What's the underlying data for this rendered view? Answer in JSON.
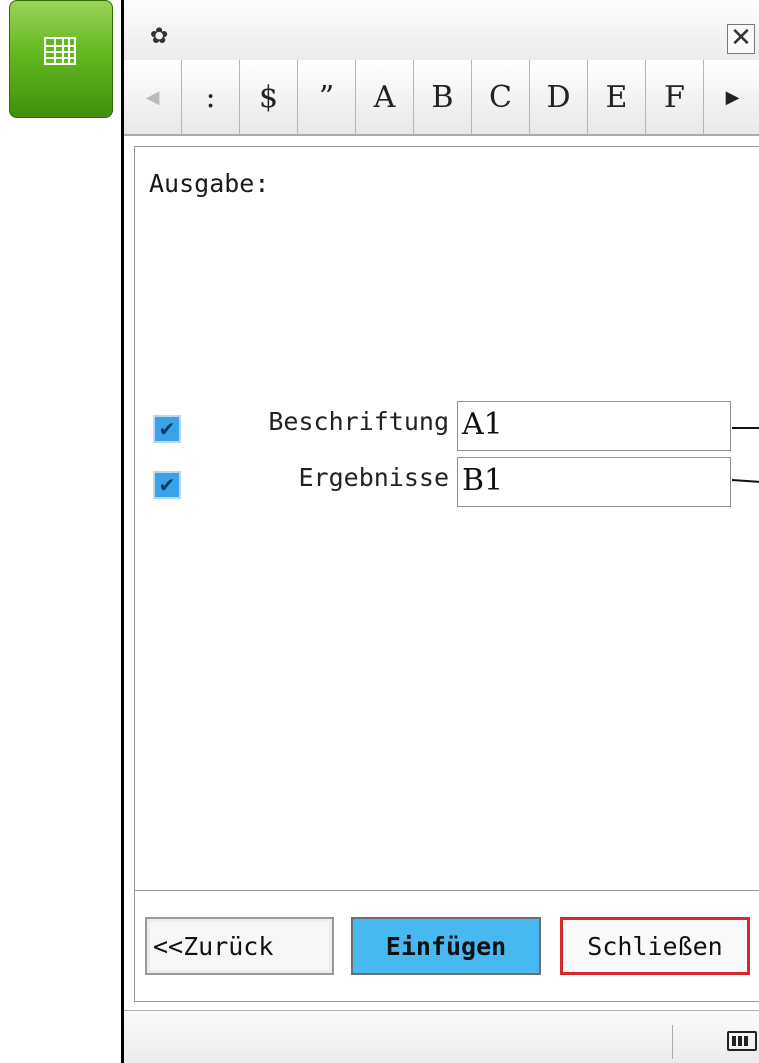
{
  "app_icon": {
    "icon": "spreadsheet-grid-icon"
  },
  "titlebar": {
    "settings_icon": "gear-icon",
    "close_label": "✕"
  },
  "keybar": {
    "keys": [
      "◀",
      ":",
      "$",
      "”",
      "A",
      "B",
      "C",
      "D",
      "E",
      "F",
      "▶"
    ]
  },
  "panel": {
    "heading": "Ausgabe:",
    "rows": [
      {
        "label": "Beschriftung",
        "value": "A1",
        "checked": true
      },
      {
        "label": "Ergebnisse",
        "value": "B1",
        "checked": true
      }
    ]
  },
  "buttons": {
    "back": "<<Zurück",
    "insert": "Einfügen",
    "close": "Schließen"
  },
  "status": {
    "battery_icon": "battery-icon"
  },
  "colors": {
    "accent_blue": "#48b8f0",
    "highlight_red": "#d62a2a",
    "app_green": "#63b81f"
  }
}
